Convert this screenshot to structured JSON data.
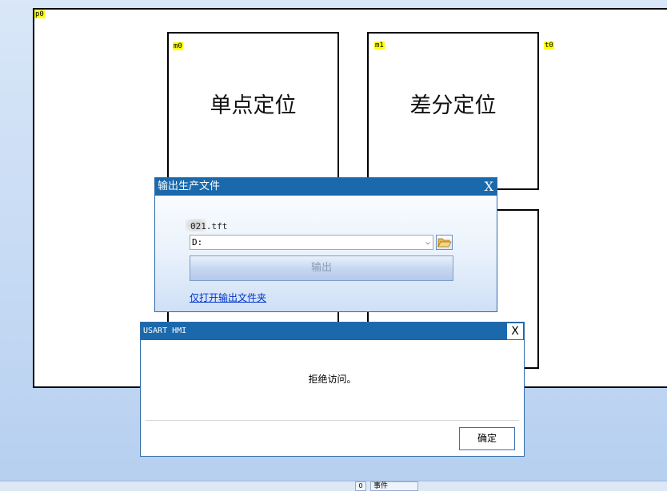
{
  "canvas": {
    "page_tag": "p0",
    "tags": {
      "m0": "m0",
      "m1": "m1",
      "t0": "t0"
    },
    "box_single": {
      "label": "单点定位"
    },
    "box_diff": {
      "label": "差分定位"
    }
  },
  "export_dialog": {
    "title": "输出生产文件",
    "close": "X",
    "filename": "021.tft",
    "path_value": "D:",
    "export_label": "输出",
    "open_folder_link": "仅打开输出文件夹",
    "folder_icon": "folder-open-icon"
  },
  "error_dialog": {
    "title": "USART HMI",
    "close": "X",
    "message": "拒绝访问。",
    "ok_label": "确定"
  },
  "statusbar": {
    "cell_a": "0",
    "cell_b": "事件"
  }
}
